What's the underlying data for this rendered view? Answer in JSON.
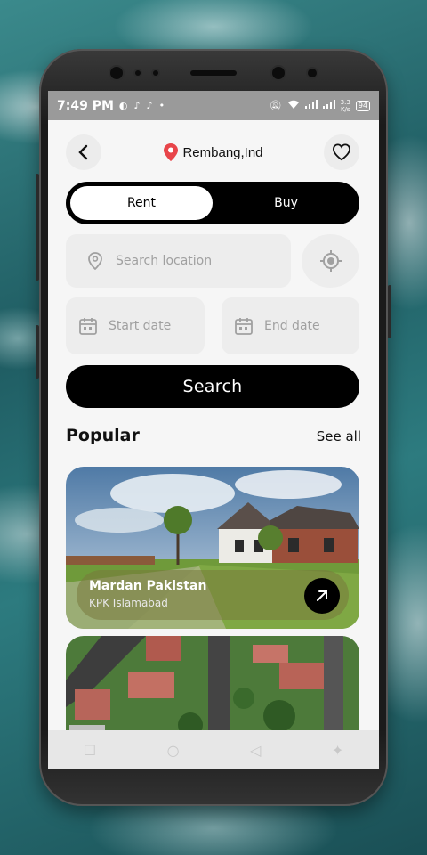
{
  "status_bar": {
    "time": "7:49 PM",
    "net_speed": "3.3\nK/s",
    "battery": "94"
  },
  "header": {
    "location": "Rembang,Ind"
  },
  "mode_toggle": {
    "rent_label": "Rent",
    "buy_label": "Buy",
    "selected": "Rent"
  },
  "search": {
    "location_placeholder": "Search location",
    "start_placeholder": "Start date",
    "end_placeholder": "End date",
    "button_label": "Search"
  },
  "popular": {
    "title": "Popular",
    "see_all": "See all",
    "items": [
      {
        "name": "Mardan Pakistan",
        "subtitle": "KPK Islamabad"
      }
    ]
  },
  "colors": {
    "accent": "#000000",
    "pin": "#e8454a",
    "field_bg": "#ededed",
    "screen_bg": "#f6f6f6"
  }
}
